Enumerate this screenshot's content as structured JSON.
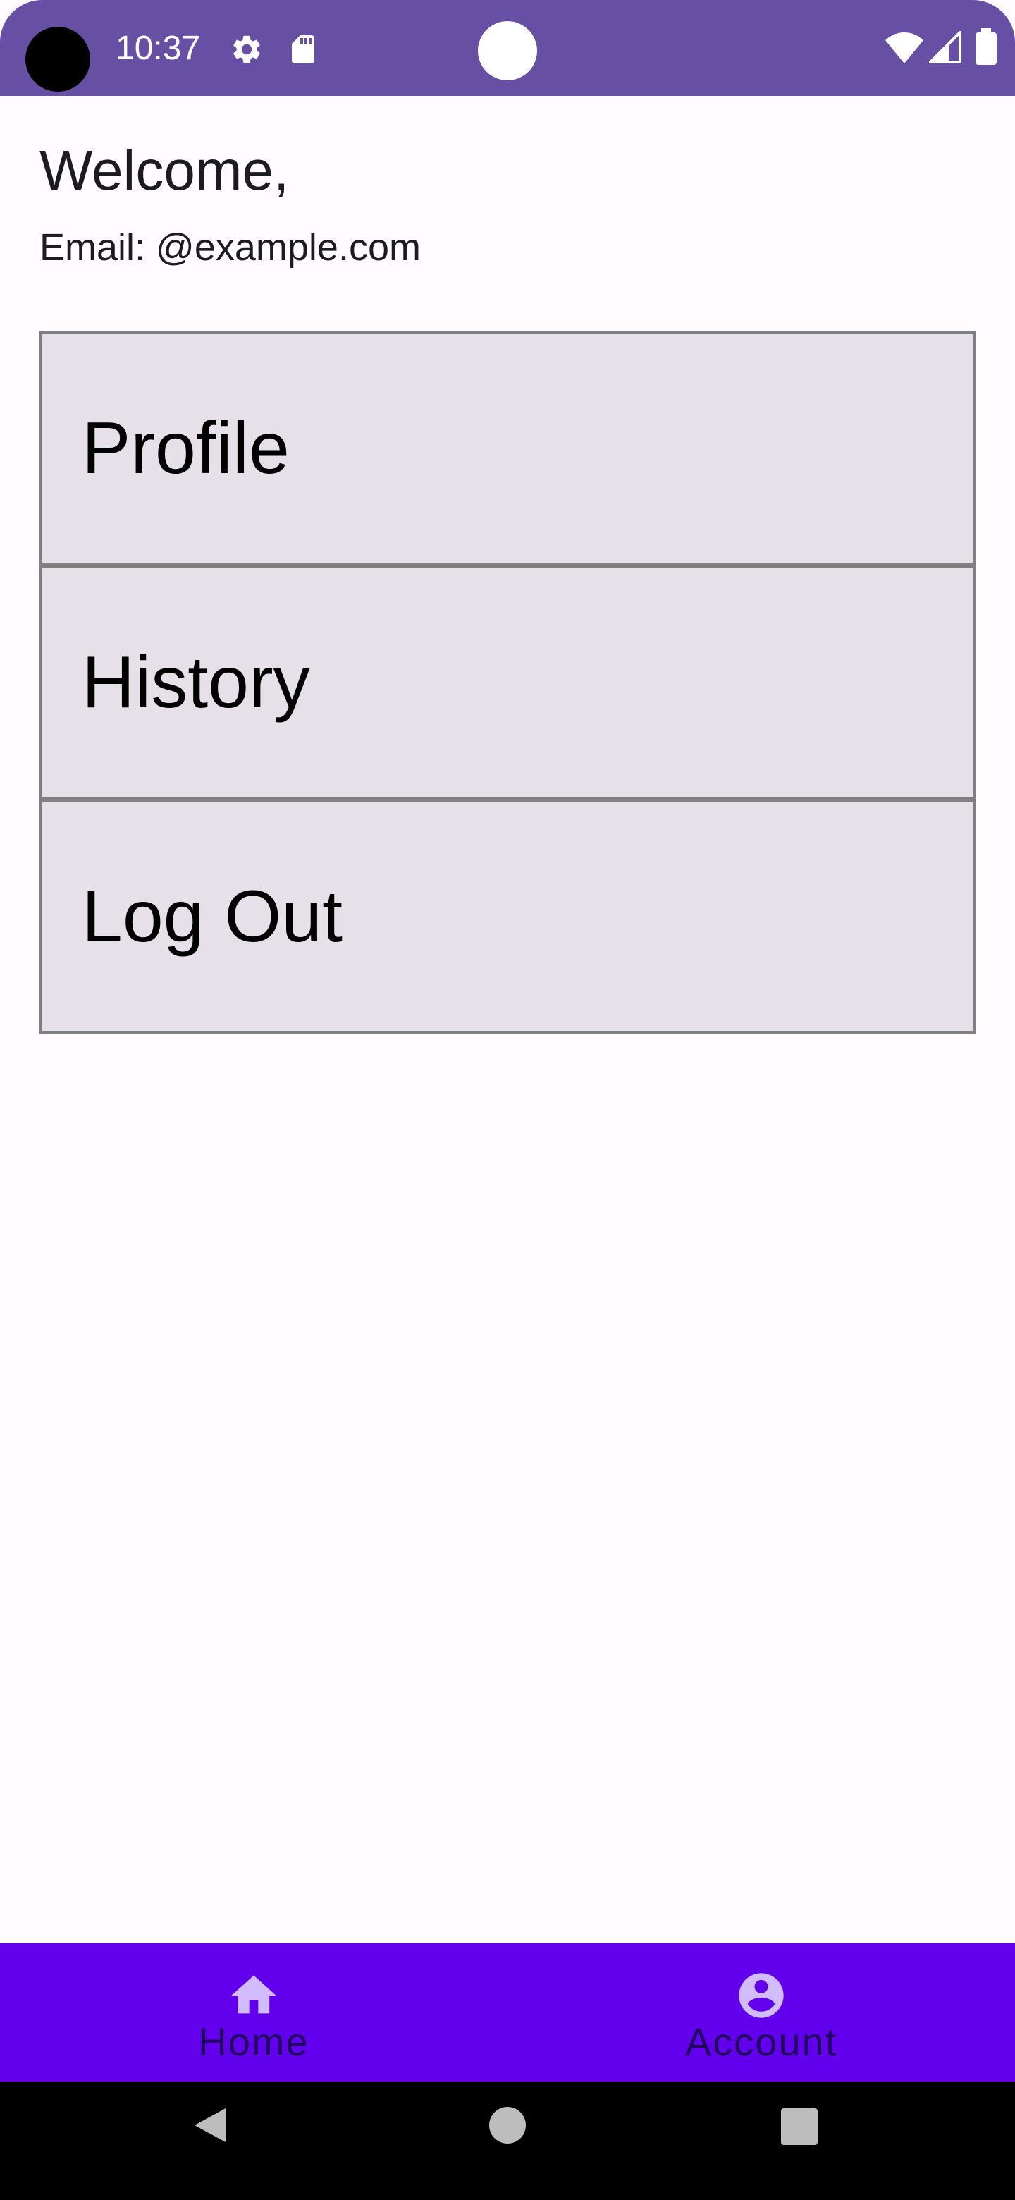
{
  "status_bar": {
    "time": "10:37",
    "icons": [
      "camera-cutout",
      "gear-icon",
      "sd-card-icon",
      "wifi-icon",
      "signal-icon",
      "battery-icon"
    ],
    "background": "#6750a4"
  },
  "account": {
    "welcome": "Welcome,",
    "email": "Email: @example.com"
  },
  "menu": {
    "items": [
      {
        "label": "Profile"
      },
      {
        "label": "History"
      },
      {
        "label": "Log Out"
      }
    ],
    "item_background": "#e6e0e9",
    "border_color": "#808080"
  },
  "bottom_nav": {
    "background": "#6200ee",
    "icon_color": "#d0bcff",
    "label_color": "#21005d",
    "items": [
      {
        "label": "Home",
        "icon": "home-icon"
      },
      {
        "label": "Account",
        "icon": "account-circle-icon"
      }
    ]
  },
  "system_nav": {
    "buttons": [
      "back-icon",
      "home-circle-icon",
      "recents-icon"
    ]
  }
}
